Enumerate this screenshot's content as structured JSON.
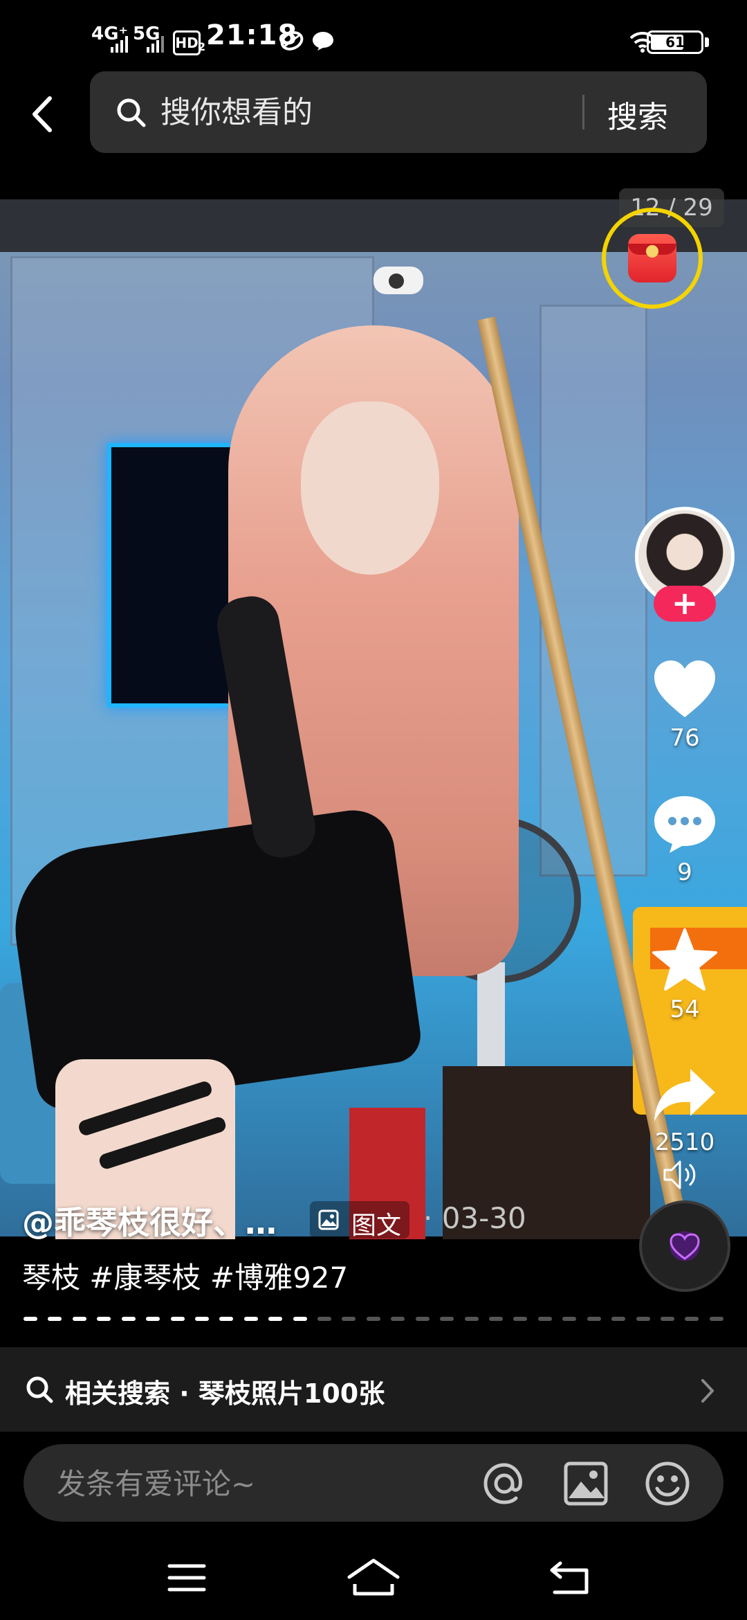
{
  "status_bar": {
    "network_1": "4G⁺",
    "network_2": "5G",
    "hd_label": "HD",
    "hd_sub": "2",
    "time": "21:18",
    "battery": "61"
  },
  "search": {
    "placeholder": "搜你想看的",
    "button_label": "搜索"
  },
  "post": {
    "page_counter": "12 / 29",
    "author": "@乖琴枝很好、…",
    "type_label": "图文",
    "date": "· 03-30",
    "hashtags": "琴枝 #康琴枝 #博雅927",
    "current_page": 12,
    "total_pages": 29
  },
  "actions": {
    "follow_label": "+",
    "likes": "76",
    "comments": "9",
    "favorites": "54",
    "shares": "2510"
  },
  "related": {
    "label": "相关搜索 · 琴枝照片100张"
  },
  "comment": {
    "placeholder": "发条有爱评论~"
  },
  "colors": {
    "follow": "#f5285b",
    "redpacket_ring": "#f4d400",
    "progress_active": "#ffffff",
    "progress_inactive": "#555555"
  },
  "icons": [
    "back-arrow-icon",
    "search-icon",
    "red-packet-icon",
    "heart-icon",
    "comment-icon",
    "star-icon",
    "share-icon",
    "mute-icon",
    "music-disc-icon",
    "image-icon",
    "at-icon",
    "emoji-icon",
    "chevron-right-icon",
    "menu-icon",
    "home-icon",
    "return-icon"
  ]
}
